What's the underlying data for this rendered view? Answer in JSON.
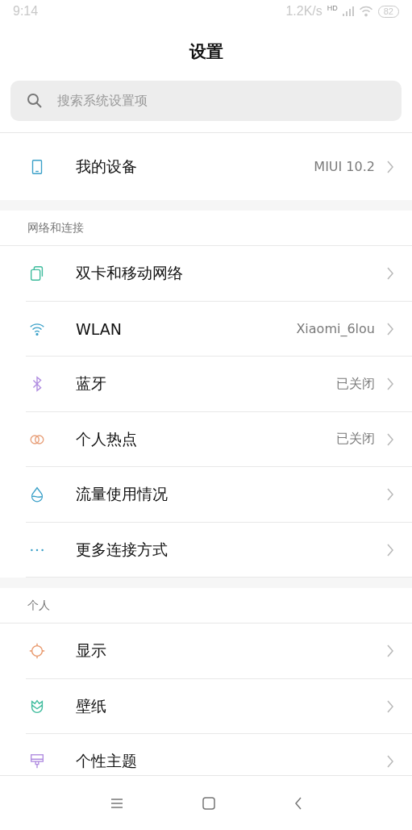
{
  "status_bar": {
    "time": "9:14",
    "speed": "1.2K/s",
    "signal_tag": "HD",
    "battery": "82"
  },
  "title": "设置",
  "search": {
    "placeholder": "搜索系统设置项"
  },
  "top_items": [
    {
      "kind": "phone",
      "label": "我的设备",
      "value": "MIUI 10.2"
    }
  ],
  "sections": [
    {
      "header": "网络和连接",
      "items": [
        {
          "kind": "sim",
          "label": "双卡和移动网络"
        },
        {
          "kind": "wifi",
          "label": "WLAN",
          "value": "Xiaomi_6lou"
        },
        {
          "kind": "bluetooth",
          "label": "蓝牙",
          "value": "已关闭"
        },
        {
          "kind": "hotspot",
          "label": "个人热点",
          "value": "已关闭"
        },
        {
          "kind": "drop",
          "label": "流量使用情况"
        },
        {
          "kind": "dots",
          "label": "更多连接方式"
        }
      ]
    },
    {
      "header": "个人",
      "items": [
        {
          "kind": "sun",
          "label": "显示"
        },
        {
          "kind": "tulip",
          "label": "壁纸"
        },
        {
          "kind": "brush",
          "label": "个性主题"
        }
      ]
    }
  ]
}
